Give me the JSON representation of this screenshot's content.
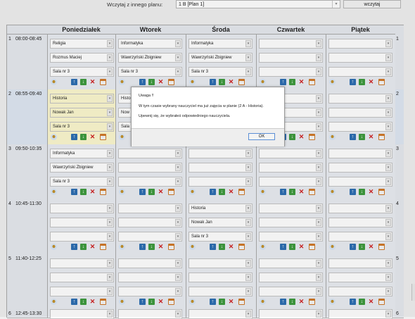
{
  "top": {
    "label": "Wczytaj z innego planu:",
    "plan": "1 B [Plan 1]",
    "button": "wczytaj"
  },
  "days": [
    "Poniedziałek",
    "Wtorek",
    "Środa",
    "Czwartek",
    "Piątek"
  ],
  "rows": [
    {
      "num": "1",
      "time": "08:00-08:45",
      "cells": [
        {
          "subject": "Religia",
          "teacher": "Rozmus Maciej",
          "room": "Sala nr 3"
        },
        {
          "subject": "Informatyka",
          "teacher": "Wawrzyński Zbigniew",
          "room": "Sala nr 3"
        },
        {
          "subject": "Informatyka",
          "teacher": "Wawrzyński Zbigniew",
          "room": "Sala nr 3"
        },
        {
          "subject": "",
          "teacher": "",
          "room": ""
        },
        {
          "subject": "",
          "teacher": "",
          "room": ""
        }
      ]
    },
    {
      "num": "2",
      "time": "08:55-09:40",
      "cells": [
        {
          "subject": "Historia",
          "teacher": "Nowak Jan",
          "room": "Sala nr 3"
        },
        {
          "subject": "Histo",
          "teacher": "Now",
          "room": "Sala"
        },
        {
          "subject": "",
          "teacher": "",
          "room": ""
        },
        {
          "subject": "",
          "teacher": "",
          "room": ""
        },
        {
          "subject": "",
          "teacher": "",
          "room": ""
        }
      ]
    },
    {
      "num": "3",
      "time": "09:50-10:35",
      "cells": [
        {
          "subject": "Informatyka",
          "teacher": "Wawrzyński Zbigniew",
          "room": "Sala nr 3"
        },
        {
          "subject": "",
          "teacher": "",
          "room": ""
        },
        {
          "subject": "",
          "teacher": "",
          "room": ""
        },
        {
          "subject": "",
          "teacher": "",
          "room": ""
        },
        {
          "subject": "",
          "teacher": "",
          "room": ""
        }
      ]
    },
    {
      "num": "4",
      "time": "10:45-11:30",
      "cells": [
        {
          "subject": "",
          "teacher": "",
          "room": ""
        },
        {
          "subject": "",
          "teacher": "",
          "room": ""
        },
        {
          "subject": "Historia",
          "teacher": "Nowak Jan",
          "room": "Sala nr 3"
        },
        {
          "subject": "",
          "teacher": "",
          "room": ""
        },
        {
          "subject": "",
          "teacher": "",
          "room": ""
        }
      ]
    },
    {
      "num": "5",
      "time": "11:40-12:25",
      "cells": [
        {
          "subject": "",
          "teacher": "",
          "room": ""
        },
        {
          "subject": "",
          "teacher": "",
          "room": ""
        },
        {
          "subject": "",
          "teacher": "",
          "room": ""
        },
        {
          "subject": "",
          "teacher": "",
          "room": ""
        },
        {
          "subject": "",
          "teacher": "",
          "room": ""
        }
      ]
    },
    {
      "num": "6",
      "time": "12:45-13:30",
      "cells": [
        {
          "subject": "",
          "teacher": "",
          "room": ""
        },
        {
          "subject": "",
          "teacher": "",
          "room": ""
        },
        {
          "subject": "",
          "teacher": "",
          "room": ""
        },
        {
          "subject": "",
          "teacher": "",
          "room": ""
        },
        {
          "subject": "",
          "teacher": "",
          "room": ""
        }
      ]
    }
  ],
  "dialog": {
    "title": "Uwaga !!",
    "line1": "W tym czasie wybrany nauczyciel ma już zajęcia w planie (2 A - Historia).",
    "line2": "Upewnij się, że wybrałeś odpowiedniego nauczyciela.",
    "ok": "OK"
  },
  "icons": {
    "group": "group-icon",
    "up": "arrow-up-icon",
    "down": "arrow-down-icon",
    "delete": "delete-icon",
    "calendar": "calendar-icon"
  },
  "colors": {
    "highlight": "#fcf8cf",
    "cell": "#e9ecf2",
    "ok_border": "#5b8fd6"
  }
}
